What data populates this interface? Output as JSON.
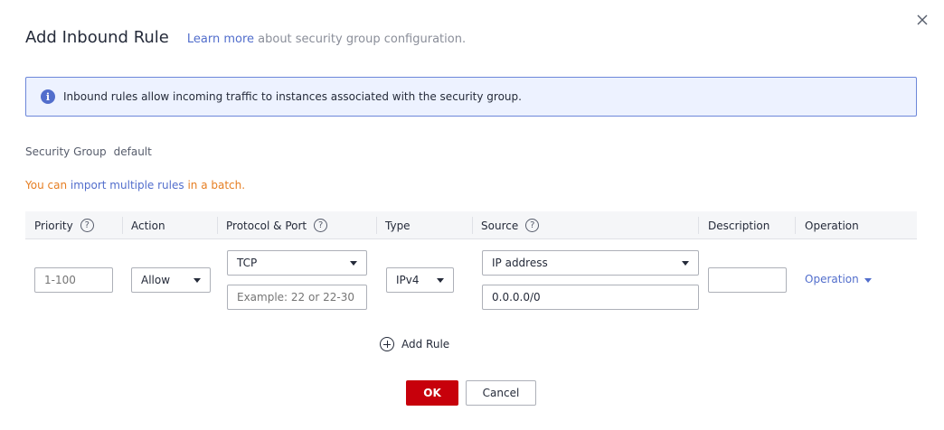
{
  "dialog": {
    "title": "Add Inbound Rule",
    "learn_more_link": "Learn more",
    "learn_more_suffix": " about security group configuration.",
    "info_text": "Inbound rules allow incoming traffic to instances associated with the security group.",
    "security_group_label": "Security Group",
    "security_group_value": "default",
    "import_prefix": "You can ",
    "import_link": "import multiple rules",
    "import_suffix": " in a batch."
  },
  "table": {
    "headers": {
      "priority": "Priority",
      "action": "Action",
      "protocol_port": "Protocol & Port",
      "type": "Type",
      "source": "Source",
      "description": "Description",
      "operation": "Operation"
    },
    "row": {
      "priority_placeholder": "1-100",
      "action_value": "Allow",
      "protocol_value": "TCP",
      "port_placeholder": "Example: 22 or 22-30",
      "type_value": "IPv4",
      "source_type_value": "IP address",
      "source_value": "0.0.0.0/0",
      "description_value": "",
      "operation_link": "Operation"
    }
  },
  "actions": {
    "add_rule_label": "Add Rule",
    "ok_label": "OK",
    "cancel_label": "Cancel"
  },
  "icons": {
    "close": "close-icon",
    "info": "info-icon",
    "help": "question-circle-icon",
    "dropdown": "chevron-down-icon",
    "add": "plus-circle-icon"
  },
  "colors": {
    "primary_button": "#c7000b",
    "link": "#526ecc",
    "info_bar_bg": "#edf2ff",
    "info_bar_border": "#6d87d9",
    "import_text": "#e67e22"
  }
}
